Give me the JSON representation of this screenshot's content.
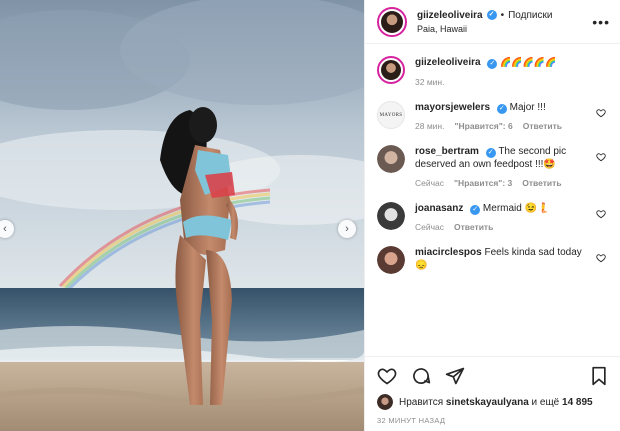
{
  "post": {
    "author": "giizeleoliveira",
    "follow_label": "Подписки",
    "location": "Paia, Hawaii",
    "separator": "•",
    "more": "•••"
  },
  "caption": {
    "username": "giizeleoliveira",
    "text": "🌈🌈🌈🌈🌈",
    "time": "32 мин."
  },
  "comments": [
    {
      "username": "mayorsjewelers",
      "verified": true,
      "text": "Major !!!",
      "time": "28 мин.",
      "likes": "\"Нравится\": 6",
      "reply": "Ответить",
      "avatar_text": "MAYORS"
    },
    {
      "username": "rose_bertram",
      "verified": true,
      "text": "The second pic deserved an own feedpost !!!🤩",
      "time": "Сейчас",
      "likes": "\"Нравится\": 3",
      "reply": "Ответить"
    },
    {
      "username": "joanasanz",
      "verified": true,
      "text": "Mermaid 😉🧜",
      "time": "Сейчас",
      "likes": "",
      "reply": "Ответить"
    },
    {
      "username": "miacirclespos",
      "verified": false,
      "text": "Feels kinda sad today😞",
      "time": "",
      "likes": "",
      "reply": ""
    }
  ],
  "likes_line": {
    "prefix": "Нравится",
    "user": "sinetskayaulyana",
    "middle": "и ещё",
    "count": "14 895"
  },
  "timestamp": "32 МИНУТ НАЗАД",
  "colors": {
    "accent": "#3897f0",
    "ring": "#d6249f",
    "muted": "#8e8e8e"
  }
}
